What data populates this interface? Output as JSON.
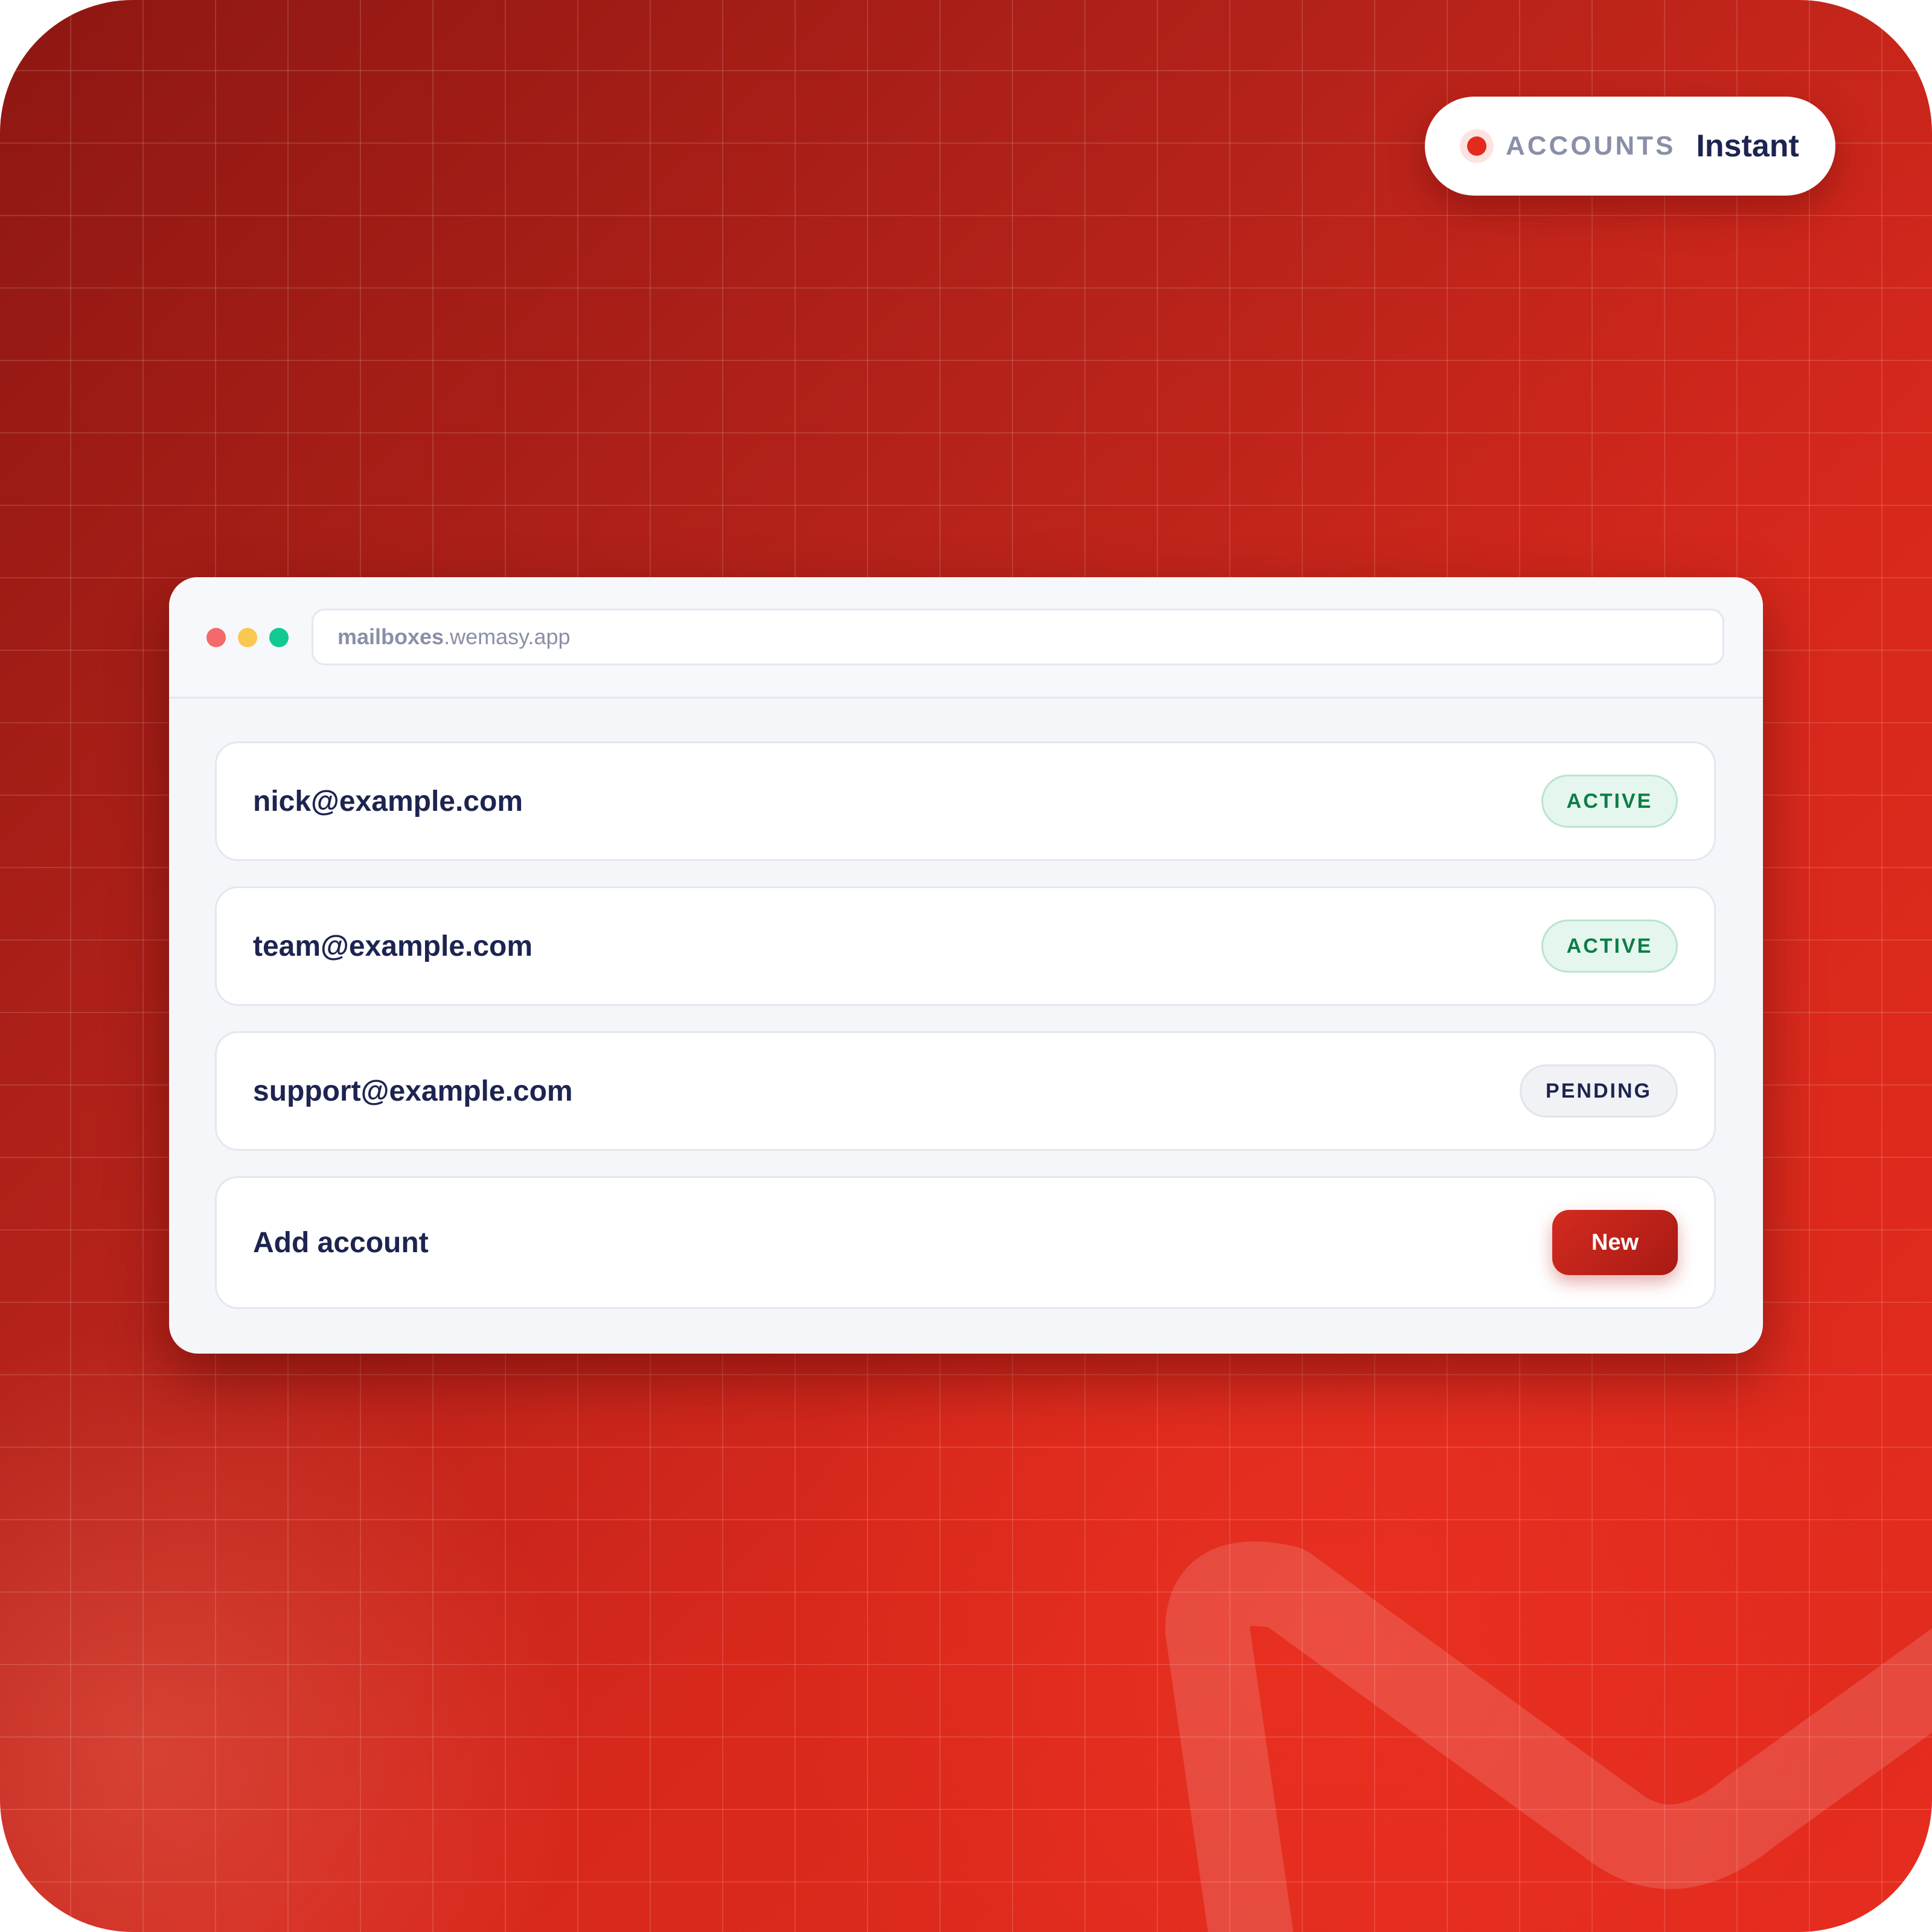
{
  "colors": {
    "background_dark": "#8e1712",
    "background_light": "#e52d1f",
    "accent": "#e32b1d",
    "text_primary": "#1d2450",
    "text_muted": "#8a8fa8",
    "active_text": "#0c7d47",
    "active_bg": "#e5f6ee"
  },
  "badge": {
    "icon": "status-dot",
    "label": "ACCOUNTS",
    "value": "Instant"
  },
  "window": {
    "traffic_lights": [
      "close",
      "minimize",
      "maximize"
    ],
    "url": {
      "host": "mailboxes",
      "domain": ".wemasy.app"
    },
    "accounts": [
      {
        "email": "nick@example.com",
        "status": "ACTIVE"
      },
      {
        "email": "team@example.com",
        "status": "ACTIVE"
      },
      {
        "email": "support@example.com",
        "status": "PENDING"
      }
    ],
    "add_row": {
      "label": "Add account",
      "button": "New"
    }
  }
}
